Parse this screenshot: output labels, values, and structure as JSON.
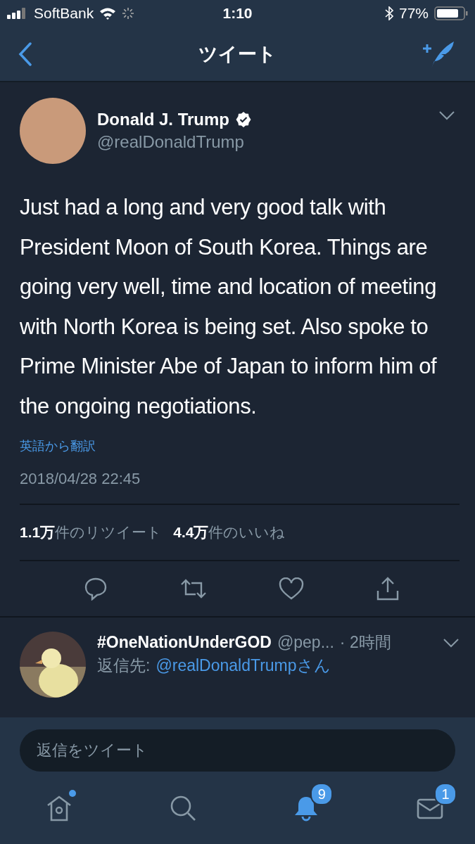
{
  "status_bar": {
    "carrier": "SoftBank",
    "time": "1:10",
    "battery": "77%"
  },
  "nav": {
    "title": "ツイート"
  },
  "tweet": {
    "name": "Donald J. Trump",
    "verified": true,
    "handle": "@realDonaldTrump",
    "text": "Just had a long and very good talk with President Moon of South Korea. Things are going very well, time and location of meeting with North Korea is being set. Also spoke to Prime Minister Abe of Japan to inform him of the ongoing negotiations.",
    "translate": "英語から翻訳",
    "timestamp": "2018/04/28 22:45",
    "retweets": "**1.1万**件のリツイート",
    "likes": "**4.4万**件のいいね"
  },
  "actions": [
    {
      "kind": "reply"
    },
    {
      "kind": "retweet"
    },
    {
      "kind": "like"
    },
    {
      "kind": "share"
    }
  ],
  "reply": {
    "name": "#OneNationUnderGOD",
    "handle": "@pep...",
    "time": "· 2時間",
    "reply_to_label": "返信先:",
    "reply_to": "@realDonaldTrumpさん"
  },
  "compose": {
    "placeholder": "返信をツイート"
  },
  "tab_bar": [
    {
      "kind": "home",
      "selected": false,
      "dot": true
    },
    {
      "kind": "search",
      "selected": false,
      "dot": false
    },
    {
      "kind": "notifications",
      "selected": true,
      "dot": false,
      "badge": "9"
    },
    {
      "kind": "messages",
      "selected": false,
      "dot": false,
      "badge": "1"
    }
  ]
}
